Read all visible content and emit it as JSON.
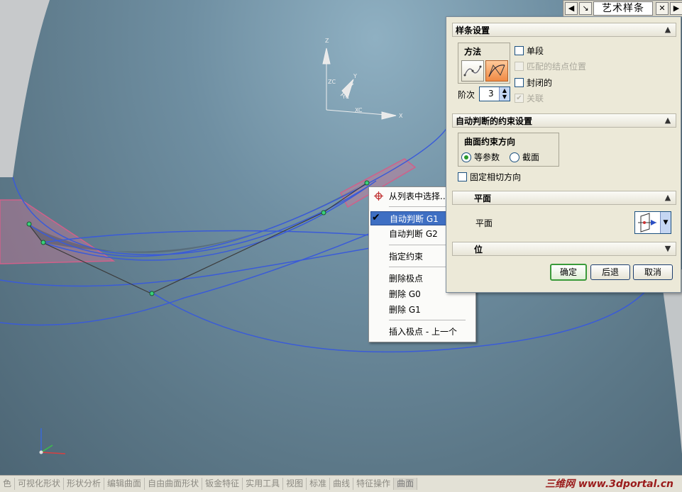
{
  "panel": {
    "title": "艺术样条",
    "spline_section": {
      "header": "样条设置",
      "method_group": "方法",
      "single_segment": "单段",
      "match_knots": "匹配的结点位置",
      "closed": "封闭的",
      "associative": "关联",
      "degree_label": "阶次",
      "degree_value": "3"
    },
    "constraint_section": {
      "header": "自动判断的约束设置",
      "surface_group": "曲面约束方向",
      "iso_param": "等参数",
      "section": "截面",
      "fixed_tangent": "固定相切方向"
    },
    "plane_section": {
      "header_partial": "平面",
      "row_partial": "平面"
    },
    "position_section": {
      "header_partial": "位"
    },
    "buttons": {
      "ok": "确定",
      "back": "后退",
      "cancel": "取消"
    }
  },
  "context_menu": {
    "items": [
      {
        "label": "从列表中选择...",
        "icon": "crosshair-icon"
      },
      {
        "label": "自动判断 G1",
        "checked": true,
        "selected": true
      },
      {
        "label": "自动判断 G2"
      },
      {
        "label": "指定约束"
      },
      {
        "label": "删除极点"
      },
      {
        "label": "删除 G0"
      },
      {
        "label": "删除 G1"
      },
      {
        "label": "插入极点 - 上一个"
      }
    ]
  },
  "viewport": {
    "triad_labels": {
      "z": "Z",
      "zc": "ZC",
      "y": "Y",
      "yc": "YC",
      "x": "X",
      "xc": "XC"
    }
  },
  "bottom_toolbar": {
    "items": [
      "色",
      "可视化形状",
      "形状分析",
      "编辑曲面",
      "自由曲面形状",
      "钣金特征",
      "实用工具",
      "视图",
      "标准",
      "曲线",
      "特征操作",
      "曲面"
    ],
    "active": "曲面"
  },
  "watermark": "三维网 www.3dportal.cn",
  "colors": {
    "selection": "#3e6fc3",
    "ok_border": "#3a9a3a",
    "curve": "#3a5bd8",
    "method_active": "#f39a5a"
  }
}
